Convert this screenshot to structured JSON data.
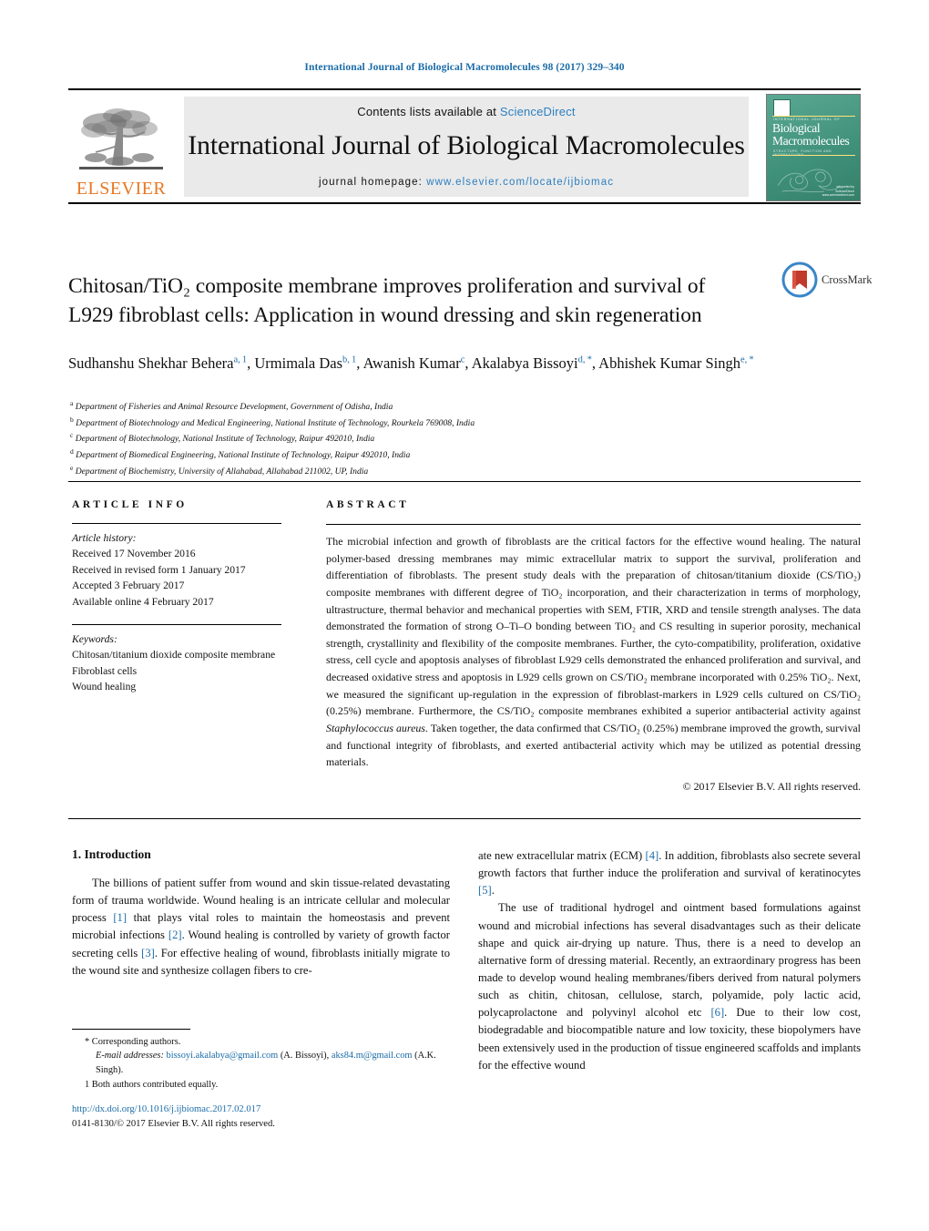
{
  "running_head": "International Journal of Biological Macromolecules 98 (2017) 329–340",
  "masthead": {
    "publisher_name": "ELSEVIER",
    "contents_line_prefix": "Contents lists available at ",
    "contents_link": "ScienceDirect",
    "journal_title": "International Journal of Biological Macromolecules",
    "homepage_label": "journal homepage: ",
    "homepage_url": "www.elsevier.com/locate/ijbiomac",
    "cover": {
      "kicker": "INTERNATIONAL JOURNAL OF",
      "title_line1": "Biological",
      "title_line2": "Macromolecules",
      "subtitle": "STRUCTURE, FUNCTION AND INTERACTIONS",
      "footer_line1": "supported by",
      "footer_line2": "ScienceDirect",
      "footer_line3": "www.sciencedirect.com"
    }
  },
  "article": {
    "title": "Chitosan/TiO₂ composite membrane improves proliferation and survival of L929 fibroblast cells: Application in wound dressing and skin regeneration",
    "crossmark_label": "CrossMark",
    "authors_html": "Sudhanshu Shekhar Behera<sup>a,&#8201;1</sup>, Urmimala Das<sup>b,&#8201;1</sup>, Awanish Kumar<sup>c</sup>, Akalabya Bissoyi<sup>d,&#8201;*</sup>, Abhishek Kumar Singh<sup>e,&#8201;*</sup>",
    "affiliations": [
      {
        "label": "a",
        "text": "Department of Fisheries and Animal Resource Development, Government of Odisha, India"
      },
      {
        "label": "b",
        "text": "Department of Biotechnology and Medical Engineering, National Institute of Technology, Rourkela 769008, India"
      },
      {
        "label": "c",
        "text": "Department of Biotechnology, National Institute of Technology, Raipur 492010, India"
      },
      {
        "label": "d",
        "text": "Department of Biomedical Engineering, National Institute of Technology, Raipur 492010, India"
      },
      {
        "label": "e",
        "text": "Department of Biochemistry, University of Allahabad, Allahabad 211002, UP, India"
      }
    ]
  },
  "article_info": {
    "heading": "ARTICLE INFO",
    "history_label": "Article history:",
    "history": [
      "Received 17 November 2016",
      "Received in revised form 1 January 2017",
      "Accepted 3 February 2017",
      "Available online 4 February 2017"
    ],
    "keywords_label": "Keywords:",
    "keywords": [
      "Chitosan/titanium dioxide composite membrane",
      "Fibroblast cells",
      "Wound healing"
    ]
  },
  "abstract": {
    "heading": "ABSTRACT",
    "body": "The microbial infection and growth of fibroblasts are the critical factors for the effective wound healing. The natural polymer-based dressing membranes may mimic extracellular matrix to support the survival, proliferation and differentiation of fibroblasts. The present study deals with the preparation of chitosan/titanium dioxide (CS/TiO₂) composite membranes with different degree of TiO₂ incorporation, and their characterization in terms of morphology, ultrastructure, thermal behavior and mechanical properties with SEM, FTIR, XRD and tensile strength analyses. The data demonstrated the formation of strong O–Ti–O bonding between TiO₂ and CS resulting in superior porosity, mechanical strength, crystallinity and flexibility of the composite membranes. Further, the cyto-compatibility, proliferation, oxidative stress, cell cycle and apoptosis analyses of fibroblast L929 cells demonstrated the enhanced proliferation and survival, and decreased oxidative stress and apoptosis in L929 cells grown on CS/TiO₂ membrane incorporated with 0.25% TiO₂. Next, we measured the significant up-regulation in the expression of fibroblast-markers in L929 cells cultured on CS/TiO₂ (0.25%) membrane. Furthermore, the CS/TiO₂ composite membranes exhibited a superior antibacterial activity against Staphylococcus aureus. Taken together, the data confirmed that CS/TiO₂ (0.25%) membrane improved the growth, survival and functional integrity of fibroblasts, and exerted antibacterial activity which may be utilized as potential dressing materials.",
    "copyright": "© 2017 Elsevier B.V. All rights reserved."
  },
  "body": {
    "section_heading": "1. Introduction",
    "left_paragraph_1": "The billions of patient suffer from wound and skin tissue-related devastating form of trauma worldwide. Wound healing is an intricate cellular and molecular process [1] that plays vital roles to maintain the homeostasis and prevent microbial infections [2]. Wound healing is controlled by variety of growth factor secreting cells [3]. For effective healing of wound, fibroblasts initially migrate to the wound site and synthesize collagen fibers to cre-",
    "right_paragraph_1": "ate new extracellular matrix (ECM) [4]. In addition, fibroblasts also secrete several growth factors that further induce the proliferation and survival of keratinocytes [5].",
    "right_paragraph_2": "The use of traditional hydrogel and ointment based formulations against wound and microbial infections has several disadvantages such as their delicate shape and quick air-drying up nature. Thus, there is a need to develop an alternative form of dressing material. Recently, an extraordinary progress has been made to develop wound healing membranes/fibers derived from natural polymers such as chitin, chitosan, cellulose, starch, polyamide, poly lactic acid, polycaprolactone and polyvinyl alcohol etc [6]. Due to their low cost, biodegradable and biocompatible nature and low toxicity, these biopolymers have been extensively used in the production of tissue engineered scaffolds and implants for the effective wound"
  },
  "footnotes": {
    "corresponding": "* Corresponding authors.",
    "email_label": "E-mail addresses:",
    "email_1": "bissoyi.akalabya@gmail.com",
    "email_1_owner": "(A. Bissoyi),",
    "email_2": "aks84.m@gmail.com",
    "email_2_owner": "(A.K. Singh).",
    "equal_contribution": "1  Both authors contributed equally."
  },
  "footer": {
    "doi": "http://dx.doi.org/10.1016/j.ijbiomac.2017.02.017",
    "issn_line": "0141-8130/© 2017 Elsevier B.V. All rights reserved."
  },
  "colors": {
    "link_blue": "#1b6ca8",
    "elsevier_orange": "#E87722",
    "cover_green": "#3f9079",
    "crossmark_red": "#c0392b",
    "crossmark_blue": "#3a86c8"
  }
}
